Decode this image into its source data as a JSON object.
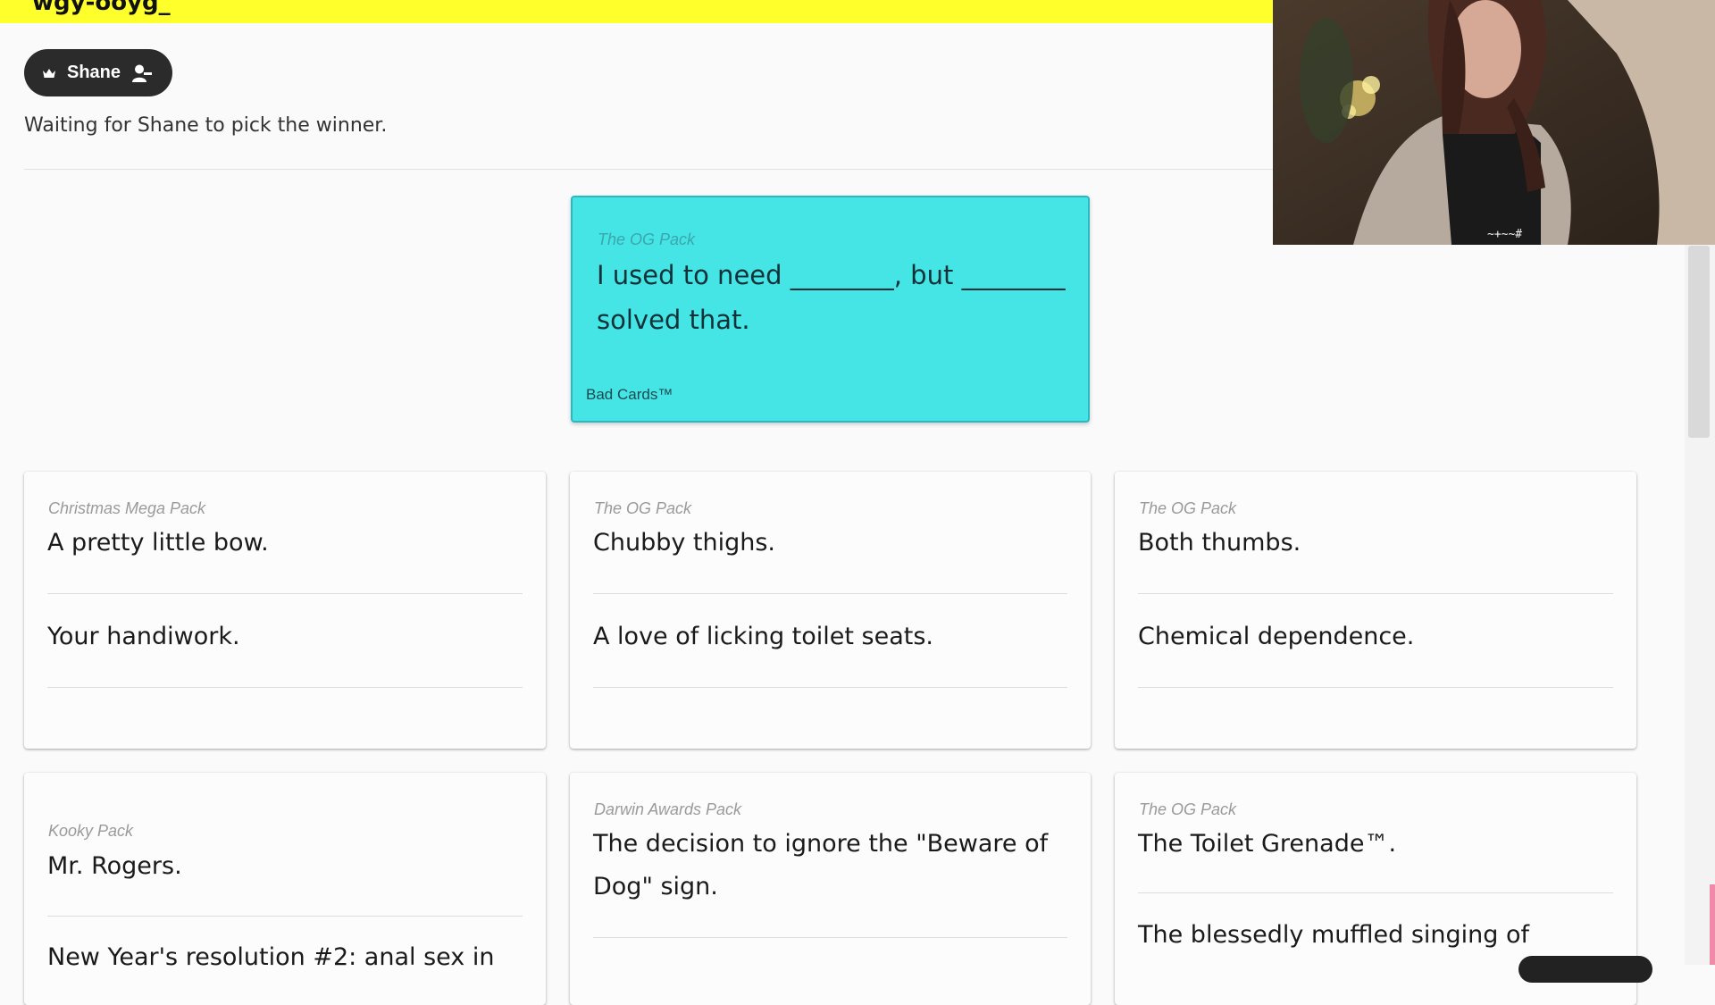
{
  "header": {
    "peek_text": "wgy-ooyg_"
  },
  "czar": {
    "name": "Shane",
    "crown_icon": "crown-icon",
    "remove_icon": "remove-user-icon"
  },
  "status_text": "Waiting for Shane to pick the winner.",
  "black_card": {
    "pack": "The OG Pack",
    "prompt": "I used to need ________, but ________ solved that.",
    "brand": "Bad Cards™",
    "color": "#45e5e5"
  },
  "submissions": [
    {
      "pack": "Christmas Mega Pack",
      "answers": [
        "A pretty little bow.",
        "Your handiwork."
      ]
    },
    {
      "pack": "The OG Pack",
      "answers": [
        "Chubby thighs.",
        "A love of licking toilet seats."
      ]
    },
    {
      "pack": "The OG Pack",
      "answers": [
        "Both thumbs.",
        "Chemical dependence."
      ]
    },
    {
      "pack": "Kooky Pack",
      "answers": [
        "Mr. Rogers.",
        "New Year's resolution #2: anal sex in"
      ]
    },
    {
      "pack": "Darwin Awards Pack",
      "answers": [
        "The decision to ignore the \"Beware of Dog\" sign."
      ]
    },
    {
      "pack": "The OG Pack",
      "answers": [
        "The Toilet Grenade™.",
        "The blessedly muffled singing of"
      ]
    }
  ],
  "colors": {
    "accent_bar": "#ffff2c",
    "chip_bg": "#2b2b2b",
    "page_bg": "#fafafa"
  }
}
